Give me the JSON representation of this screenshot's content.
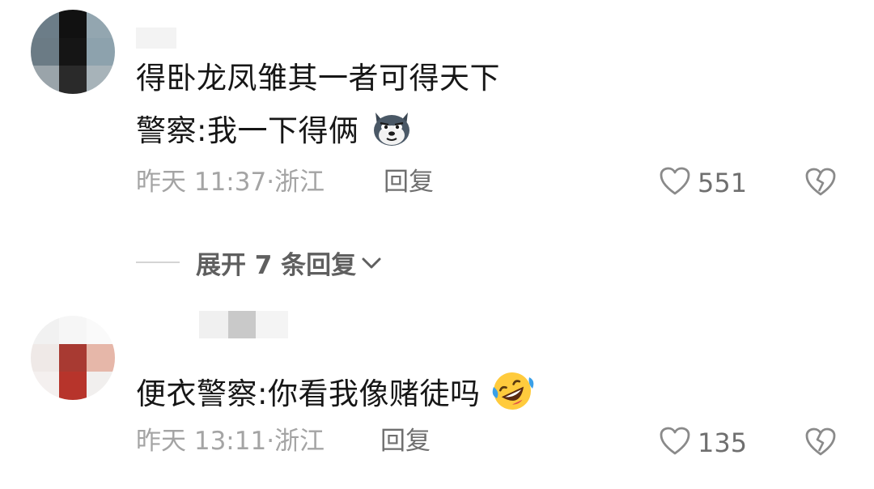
{
  "comments": [
    {
      "text_lines": [
        "得卧龙凤雏其一者可得天下",
        "警察:我一下得俩"
      ],
      "trailing_emoji": "husky-dog-emoji",
      "time": "昨天 11:37",
      "location": "浙江",
      "meta_separator": "·",
      "reply_label": "回复",
      "likes": "551",
      "expand_replies": {
        "label": "展开 7 条回复",
        "icon": "chevron-down-icon"
      }
    },
    {
      "text_lines": [
        "便衣警察:你看我像赌徒吗"
      ],
      "trailing_emoji": "rolling-on-floor-laughing-emoji",
      "time": "昨天 13:11",
      "location": "浙江",
      "meta_separator": "·",
      "reply_label": "回复",
      "likes": "135"
    }
  ],
  "icons": {
    "like": "heart-outline-icon",
    "dislike": "broken-heart-icon"
  },
  "colors": {
    "text": "#161616",
    "meta": "#a4a4a4",
    "action": "#6f6f6f"
  }
}
